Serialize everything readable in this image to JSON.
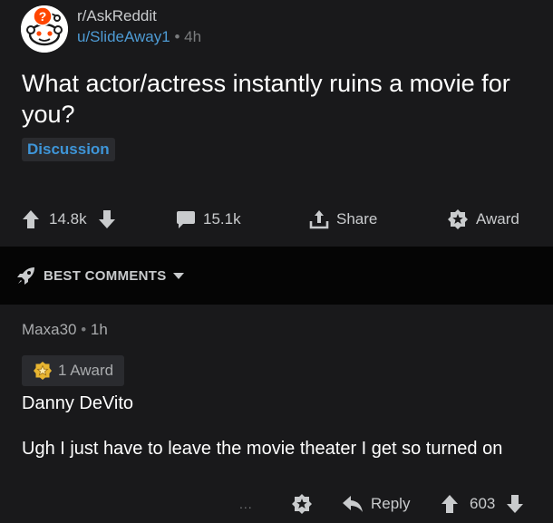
{
  "post": {
    "subreddit": "r/AskReddit",
    "author": "u/SlideAway1",
    "separator": "•",
    "age": "4h",
    "title": "What actor/actress instantly ruins a movie for you?",
    "flair": "Discussion",
    "score": "14.8k",
    "comments": "15.1k",
    "share_label": "Share",
    "award_label": "Award"
  },
  "sort": {
    "label": "BEST COMMENTS"
  },
  "comment": {
    "author": "Maxa30",
    "separator": "•",
    "age": "1h",
    "award_chip": "1 Award",
    "headline": "Danny DeVito",
    "body": "Ugh I just have to leave the movie theater I get so turned on",
    "more": "...",
    "reply_label": "Reply",
    "score": "603"
  },
  "colors": {
    "background": "#19191b",
    "sort_bar": "#050505",
    "link_blue": "#4e9bd4",
    "flair_text": "#3e95d8",
    "text": "#ffffff",
    "muted": "#c9cbcd"
  },
  "icons": [
    "reddit-snoo-icon",
    "upvote-icon",
    "downvote-icon",
    "comment-icon",
    "share-icon",
    "award-icon",
    "rocket-icon",
    "chevron-down-icon",
    "more-icon",
    "reply-icon",
    "award-badge-icon"
  ]
}
